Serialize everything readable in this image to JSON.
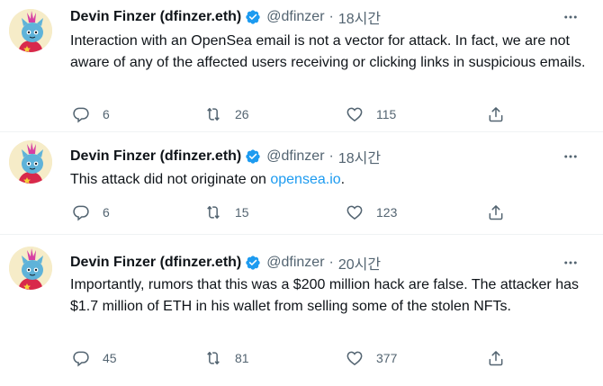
{
  "tweets": [
    {
      "name": "Devin Finzer (dfinzer.eth)",
      "handle": "@dfinzer",
      "separator": "·",
      "time": "18시간",
      "text": "Interaction with an OpenSea email is not a vector for attack. In fact, we are not aware of any of the affected users receiving or clicking links in suspicious emails.",
      "replies": "6",
      "retweets": "26",
      "likes": "115"
    },
    {
      "name": "Devin Finzer (dfinzer.eth)",
      "handle": "@dfinzer",
      "separator": "·",
      "time": "18시간",
      "text_before": "This attack did not originate on ",
      "link": "opensea.io",
      "text_after": ".",
      "replies": "6",
      "retweets": "15",
      "likes": "123"
    },
    {
      "name": "Devin Finzer (dfinzer.eth)",
      "handle": "@dfinzer",
      "separator": "·",
      "time": "20시간",
      "text": "Importantly, rumors that this was a $200 million hack are false. The attacker has $1.7 million of ETH in his wallet from selling some of the stolen NFTs.",
      "replies": "45",
      "retweets": "81",
      "likes": "377"
    }
  ],
  "icons": {
    "verified": "verified-badge-icon",
    "more": "more-options-icon",
    "reply": "reply-icon",
    "retweet": "retweet-icon",
    "like": "like-icon",
    "share": "share-icon"
  },
  "colors": {
    "accent": "#1d9bf0",
    "secondary_text": "#536471",
    "primary_text": "#0f1419"
  }
}
